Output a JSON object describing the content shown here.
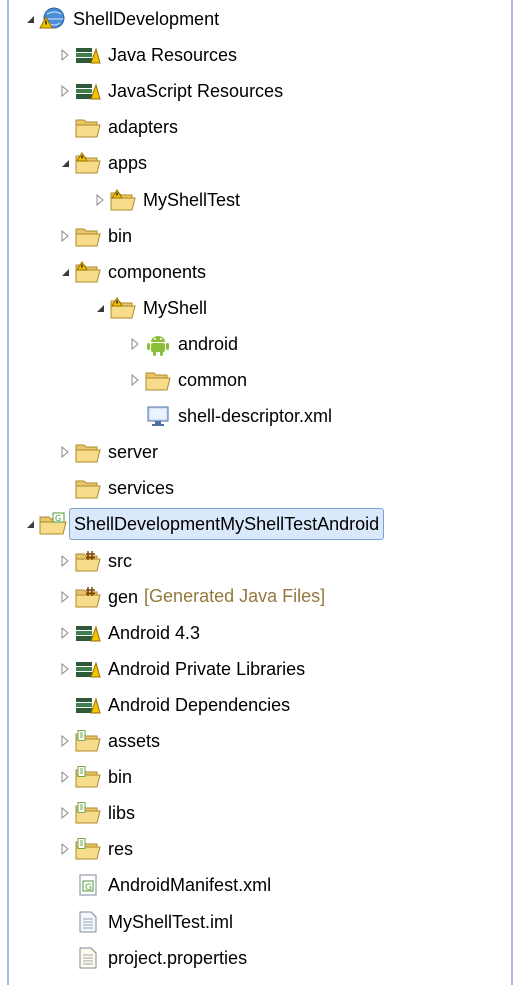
{
  "tree": [
    {
      "depth": 0,
      "twisty": "expanded",
      "icon": "project-warning-icon",
      "label": "ShellDevelopment",
      "name": "tree-item-shelldevelopment"
    },
    {
      "depth": 1,
      "twisty": "collapsed",
      "icon": "library-icon",
      "label": "Java Resources",
      "name": "tree-item-java-resources"
    },
    {
      "depth": 1,
      "twisty": "collapsed",
      "icon": "library-icon",
      "label": "JavaScript Resources",
      "name": "tree-item-javascript-resources"
    },
    {
      "depth": 1,
      "twisty": "none",
      "icon": "folder-icon",
      "label": "adapters",
      "name": "tree-item-adapters"
    },
    {
      "depth": 1,
      "twisty": "expanded",
      "icon": "folder-warning-icon",
      "label": "apps",
      "name": "tree-item-apps"
    },
    {
      "depth": 2,
      "twisty": "collapsed",
      "icon": "folder-warning-icon",
      "label": "MyShellTest",
      "name": "tree-item-myshelltest"
    },
    {
      "depth": 1,
      "twisty": "collapsed",
      "icon": "folder-icon",
      "label": "bin",
      "name": "tree-item-bin"
    },
    {
      "depth": 1,
      "twisty": "expanded",
      "icon": "folder-warning-icon",
      "label": "components",
      "name": "tree-item-components"
    },
    {
      "depth": 2,
      "twisty": "expanded",
      "icon": "folder-warning-icon",
      "label": "MyShell",
      "name": "tree-item-myshell"
    },
    {
      "depth": 3,
      "twisty": "collapsed",
      "icon": "android-icon",
      "label": "android",
      "name": "tree-item-android"
    },
    {
      "depth": 3,
      "twisty": "collapsed",
      "icon": "folder-icon",
      "label": "common",
      "name": "tree-item-common"
    },
    {
      "depth": 3,
      "twisty": "none",
      "icon": "monitor-xml-icon",
      "label": "shell-descriptor.xml",
      "name": "tree-item-shell-descriptor"
    },
    {
      "depth": 1,
      "twisty": "collapsed",
      "icon": "folder-icon",
      "label": "server",
      "name": "tree-item-server"
    },
    {
      "depth": 1,
      "twisty": "none",
      "icon": "folder-icon",
      "label": "services",
      "name": "tree-item-services"
    },
    {
      "depth": 0,
      "twisty": "expanded",
      "icon": "android-project-icon",
      "label": "ShellDevelopmentMyShellTestAndroid",
      "name": "tree-item-shelldevelopmentmyshelltestandroid",
      "selected": true
    },
    {
      "depth": 1,
      "twisty": "collapsed",
      "icon": "source-folder-icon",
      "label": "src",
      "name": "tree-item-src"
    },
    {
      "depth": 1,
      "twisty": "collapsed",
      "icon": "source-folder-icon",
      "label": "gen",
      "deco": "[Generated Java Files]",
      "name": "tree-item-gen"
    },
    {
      "depth": 1,
      "twisty": "collapsed",
      "icon": "library-icon",
      "label": "Android 4.3",
      "name": "tree-item-android-4-3"
    },
    {
      "depth": 1,
      "twisty": "collapsed",
      "icon": "library-icon",
      "label": "Android Private Libraries",
      "name": "tree-item-android-private-libraries"
    },
    {
      "depth": 1,
      "twisty": "none",
      "icon": "library-icon",
      "label": "Android Dependencies",
      "name": "tree-item-android-dependencies"
    },
    {
      "depth": 1,
      "twisty": "collapsed",
      "icon": "folder-linked-icon",
      "label": "assets",
      "name": "tree-item-assets"
    },
    {
      "depth": 1,
      "twisty": "collapsed",
      "icon": "folder-linked-icon",
      "label": "bin",
      "name": "tree-item-bin-android"
    },
    {
      "depth": 1,
      "twisty": "collapsed",
      "icon": "folder-linked-icon",
      "label": "libs",
      "name": "tree-item-libs"
    },
    {
      "depth": 1,
      "twisty": "collapsed",
      "icon": "folder-linked-icon",
      "label": "res",
      "name": "tree-item-res"
    },
    {
      "depth": 1,
      "twisty": "none",
      "icon": "android-manifest-icon",
      "label": "AndroidManifest.xml",
      "name": "tree-item-androidmanifest"
    },
    {
      "depth": 1,
      "twisty": "none",
      "icon": "text-file-icon",
      "label": "MyShellTest.iml",
      "name": "tree-item-myshelltest-iml"
    },
    {
      "depth": 1,
      "twisty": "none",
      "icon": "properties-file-icon",
      "label": "project.properties",
      "name": "tree-item-project-properties"
    }
  ]
}
